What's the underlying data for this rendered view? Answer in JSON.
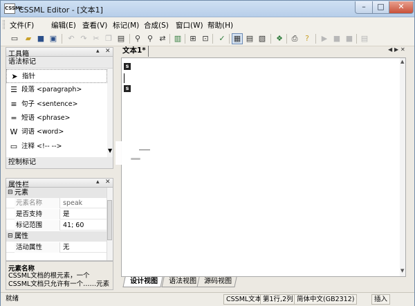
{
  "window": {
    "title": "CSSML Editor - [文本1]",
    "app_icon": "CSSML"
  },
  "menu": [
    {
      "label": "文件(F)"
    },
    {
      "label": "编辑(E)"
    },
    {
      "label": "查看(V)"
    },
    {
      "label": "标记(M)"
    },
    {
      "label": "合成(S)"
    },
    {
      "label": "窗口(W)"
    },
    {
      "label": "帮助(H)"
    }
  ],
  "toolbar": {
    "icons": [
      "new-icon",
      "open-icon",
      "save-icon",
      "save-all-icon",
      "undo-icon",
      "redo-icon",
      "cut-icon",
      "copy-icon",
      "paste-icon",
      "find-icon",
      "find-next-icon",
      "replace-icon",
      "bookmark-icon",
      "insert-tag-icon",
      "insert-attr-icon",
      "validate-icon",
      "design-view-icon",
      "source-view-icon",
      "tree-view-icon",
      "check-icon",
      "print-icon",
      "help-icon",
      "play-icon",
      "pause-icon",
      "stop-icon",
      "export-icon"
    ]
  },
  "toolbox": {
    "title": "工具箱",
    "groups": {
      "grammar": "语法标记",
      "control": "控制标记"
    },
    "items": [
      {
        "icon": "pointer-icon",
        "label": "指针"
      },
      {
        "icon": "paragraph-icon",
        "label": "段落 <paragraph>"
      },
      {
        "icon": "sentence-icon",
        "label": "句子 <sentence>"
      },
      {
        "icon": "phrase-icon",
        "label": "短语 <phrase>"
      },
      {
        "icon": "word-icon",
        "label": "词语 <word>"
      },
      {
        "icon": "comment-icon",
        "label": "注释 <!-- -->"
      }
    ]
  },
  "properties": {
    "title": "属性栏",
    "categories": [
      {
        "name": "元素",
        "rows": [
          {
            "key": "元素名称",
            "value": "speak"
          },
          {
            "key": "是否支持",
            "value": "是"
          },
          {
            "key": "标记范围",
            "value": "41; 60"
          }
        ]
      },
      {
        "name": "属性",
        "rows": [
          {
            "key": "活动属性",
            "value": "无"
          }
        ]
      }
    ]
  },
  "description": {
    "title": "元素名称",
    "text": "CSSML文档的根元素，一个CSSML文档只允许有一个……元素"
  },
  "document": {
    "tab": "文本1*",
    "view_tabs": [
      "设计视图",
      "语法视图",
      "源码视图"
    ],
    "active_view": "设计视图"
  },
  "status": {
    "ready": "就绪",
    "doc_type": "CSSML文本",
    "position": "第1行,2列",
    "encoding": "简体中文(GB2312)",
    "mode": "插入"
  },
  "colors": {
    "titlebar": "#b7cee9",
    "close_button": "#c8513a",
    "panel_header": "#e1e1e1"
  }
}
